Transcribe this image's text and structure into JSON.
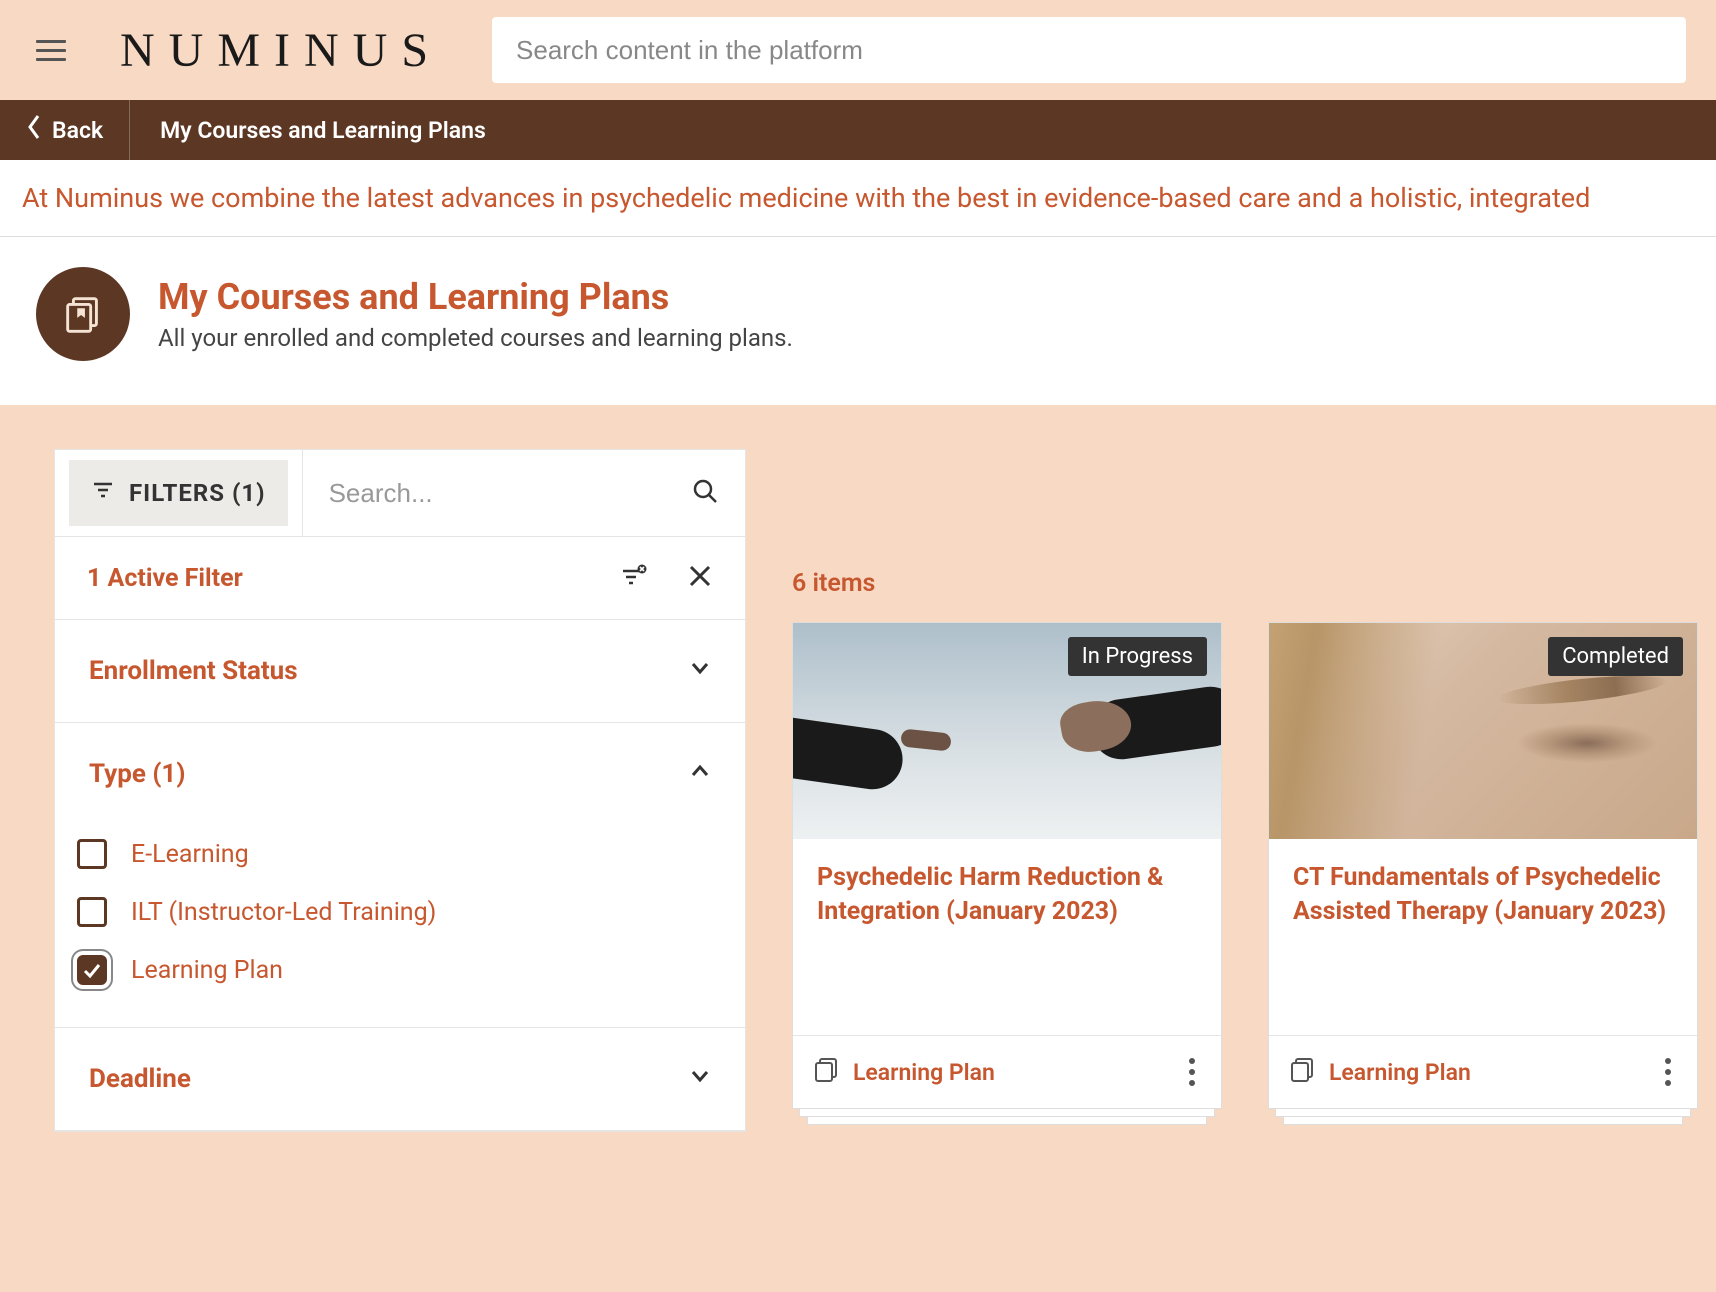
{
  "brand": "NUMINUS",
  "search": {
    "placeholder": "Search content in the platform"
  },
  "breadcrumb": {
    "back": "Back",
    "title": "My Courses and Learning Plans"
  },
  "banner": "At Numinus we combine the latest advances in psychedelic medicine with the best in evidence-based care and a holistic, integrated",
  "page": {
    "title": "My Courses and Learning Plans",
    "subtitle": "All your enrolled and completed courses and learning plans."
  },
  "filters": {
    "button_label": "FILTERS (1)",
    "search_placeholder": "Search...",
    "active_label": "1 Active Filter",
    "sections": {
      "enrollment": {
        "label": "Enrollment Status"
      },
      "type": {
        "label": "Type (1)",
        "options": [
          {
            "label": "E-Learning",
            "checked": false
          },
          {
            "label": "ILT (Instructor-Led Training)",
            "checked": false
          },
          {
            "label": "Learning Plan",
            "checked": true
          }
        ]
      },
      "deadline": {
        "label": "Deadline"
      }
    }
  },
  "results": {
    "count_label": "6 items",
    "cards": [
      {
        "status": "In Progress",
        "title": "Psychedelic Harm Reduction & Integration (January 2023)",
        "type": "Learning Plan"
      },
      {
        "status": "Completed",
        "title": "CT Fundamentals of Psychedelic Assisted Therapy (January 2023)",
        "type": "Learning Plan"
      }
    ]
  }
}
